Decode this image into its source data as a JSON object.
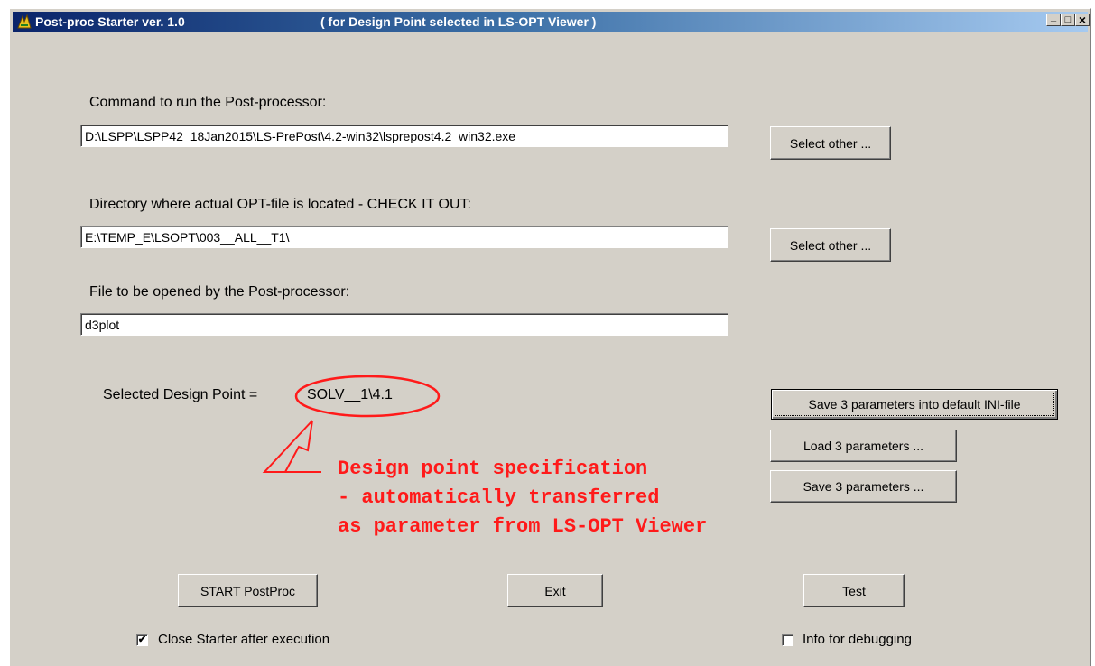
{
  "window": {
    "title": "Post-proc Starter ver. 1.0",
    "subtitle": "( for Design Point selected in LS-OPT Viewer )",
    "controls": {
      "minimize": "_",
      "maximize": "□",
      "close": "×"
    }
  },
  "command": {
    "label": "Command to run the Post-processor:",
    "value": "D:\\LSPP\\LSPP42_18Jan2015\\LS-PrePost\\4.2-win32\\lsprepost4.2_win32.exe",
    "button": "Select other ..."
  },
  "directory": {
    "label": "Directory where actual OPT-file is located - CHECK IT OUT:",
    "value": "E:\\TEMP_E\\LSOPT\\003__ALL__T1\\",
    "button": "Select other ..."
  },
  "file": {
    "label": "File to be opened by the Post-processor:",
    "value": "d3plot"
  },
  "design_point": {
    "label": "Selected Design Point  =",
    "value": "SOLV__1\\4.1"
  },
  "parameters": {
    "save_default": "Save 3 parameters into default INI-file",
    "load": "Load 3 parameters ...",
    "save": "Save 3 parameters ..."
  },
  "annotation": {
    "line1": "Design point specification",
    "line2": "- automatically transferred",
    "line3": "as parameter from LS-OPT Viewer",
    "color": "#ff1a1a"
  },
  "actions": {
    "start": "START PostProc",
    "exit": "Exit",
    "test": "Test"
  },
  "options": {
    "close_after": {
      "label": "Close Starter after execution",
      "checked": true,
      "mark": "✔"
    },
    "debug_info": {
      "label": "Info for debugging",
      "checked": false,
      "mark": ""
    }
  }
}
